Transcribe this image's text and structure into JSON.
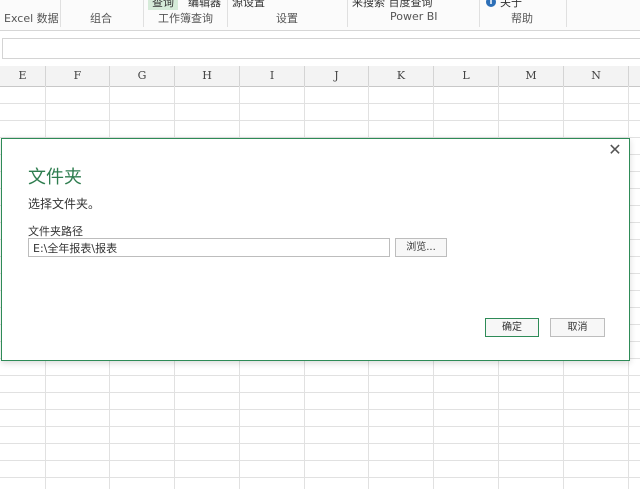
{
  "ribbon": {
    "top_items": [
      "查询",
      "编辑器",
      "源设置",
      "来搜索 百度查询"
    ],
    "info_label": "关于",
    "groups": [
      "Excel 数据",
      "组合",
      "工作簿查询",
      "设置",
      "Power BI",
      "帮助"
    ]
  },
  "sheet": {
    "columns": [
      "E",
      "F",
      "G",
      "H",
      "I",
      "J",
      "K",
      "L",
      "M",
      "N"
    ]
  },
  "dialog": {
    "title": "文件夹",
    "subtitle": "选择文件夹。",
    "path_label": "文件夹路径",
    "path_value": "E:\\全年报表\\报表",
    "browse_label": "浏览...",
    "ok_label": "确定",
    "cancel_label": "取消",
    "close_symbol": "✕"
  },
  "colors": {
    "accent": "#2e8b57",
    "title": "#2e7d4f"
  }
}
